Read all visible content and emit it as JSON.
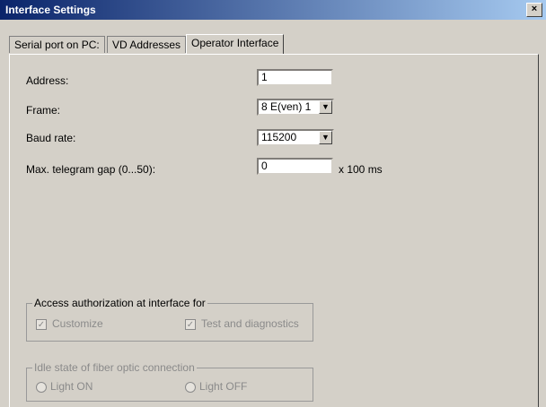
{
  "window": {
    "title": "Interface Settings",
    "close": "×"
  },
  "tabs": [
    {
      "label": "Serial port on PC:"
    },
    {
      "label": "VD Addresses"
    },
    {
      "label": "Operator Interface",
      "active": true
    }
  ],
  "fields": {
    "address": {
      "label": "Address:",
      "value": "1"
    },
    "frame": {
      "label": "Frame:",
      "value": "8 E(ven) 1"
    },
    "baud": {
      "label": "Baud rate:",
      "value": "115200"
    },
    "gap": {
      "label": "Max. telegram gap (0...50):",
      "value": "0",
      "unit": "x 100 ms"
    }
  },
  "access": {
    "title": "Access authorization at interface for",
    "customize": {
      "label": "Customize",
      "checked": true
    },
    "test": {
      "label": "Test and diagnostics",
      "checked": true
    }
  },
  "idle": {
    "title": "Idle state of fiber optic connection",
    "light_on": "Light ON",
    "light_off": "Light OFF"
  },
  "icons": {
    "dropdown": "chevron-down-icon",
    "check": "checkmark-icon"
  }
}
